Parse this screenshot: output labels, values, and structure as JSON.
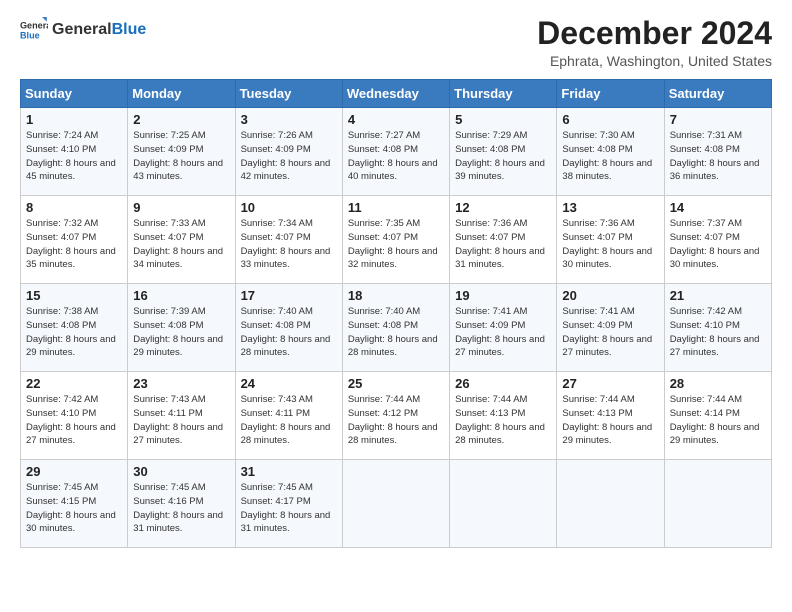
{
  "header": {
    "logo_general": "General",
    "logo_blue": "Blue",
    "title": "December 2024",
    "subtitle": "Ephrata, Washington, United States"
  },
  "weekdays": [
    "Sunday",
    "Monday",
    "Tuesday",
    "Wednesday",
    "Thursday",
    "Friday",
    "Saturday"
  ],
  "weeks": [
    [
      {
        "day": "1",
        "sunrise": "Sunrise: 7:24 AM",
        "sunset": "Sunset: 4:10 PM",
        "daylight": "Daylight: 8 hours and 45 minutes."
      },
      {
        "day": "2",
        "sunrise": "Sunrise: 7:25 AM",
        "sunset": "Sunset: 4:09 PM",
        "daylight": "Daylight: 8 hours and 43 minutes."
      },
      {
        "day": "3",
        "sunrise": "Sunrise: 7:26 AM",
        "sunset": "Sunset: 4:09 PM",
        "daylight": "Daylight: 8 hours and 42 minutes."
      },
      {
        "day": "4",
        "sunrise": "Sunrise: 7:27 AM",
        "sunset": "Sunset: 4:08 PM",
        "daylight": "Daylight: 8 hours and 40 minutes."
      },
      {
        "day": "5",
        "sunrise": "Sunrise: 7:29 AM",
        "sunset": "Sunset: 4:08 PM",
        "daylight": "Daylight: 8 hours and 39 minutes."
      },
      {
        "day": "6",
        "sunrise": "Sunrise: 7:30 AM",
        "sunset": "Sunset: 4:08 PM",
        "daylight": "Daylight: 8 hours and 38 minutes."
      },
      {
        "day": "7",
        "sunrise": "Sunrise: 7:31 AM",
        "sunset": "Sunset: 4:08 PM",
        "daylight": "Daylight: 8 hours and 36 minutes."
      }
    ],
    [
      {
        "day": "8",
        "sunrise": "Sunrise: 7:32 AM",
        "sunset": "Sunset: 4:07 PM",
        "daylight": "Daylight: 8 hours and 35 minutes."
      },
      {
        "day": "9",
        "sunrise": "Sunrise: 7:33 AM",
        "sunset": "Sunset: 4:07 PM",
        "daylight": "Daylight: 8 hours and 34 minutes."
      },
      {
        "day": "10",
        "sunrise": "Sunrise: 7:34 AM",
        "sunset": "Sunset: 4:07 PM",
        "daylight": "Daylight: 8 hours and 33 minutes."
      },
      {
        "day": "11",
        "sunrise": "Sunrise: 7:35 AM",
        "sunset": "Sunset: 4:07 PM",
        "daylight": "Daylight: 8 hours and 32 minutes."
      },
      {
        "day": "12",
        "sunrise": "Sunrise: 7:36 AM",
        "sunset": "Sunset: 4:07 PM",
        "daylight": "Daylight: 8 hours and 31 minutes."
      },
      {
        "day": "13",
        "sunrise": "Sunrise: 7:36 AM",
        "sunset": "Sunset: 4:07 PM",
        "daylight": "Daylight: 8 hours and 30 minutes."
      },
      {
        "day": "14",
        "sunrise": "Sunrise: 7:37 AM",
        "sunset": "Sunset: 4:07 PM",
        "daylight": "Daylight: 8 hours and 30 minutes."
      }
    ],
    [
      {
        "day": "15",
        "sunrise": "Sunrise: 7:38 AM",
        "sunset": "Sunset: 4:08 PM",
        "daylight": "Daylight: 8 hours and 29 minutes."
      },
      {
        "day": "16",
        "sunrise": "Sunrise: 7:39 AM",
        "sunset": "Sunset: 4:08 PM",
        "daylight": "Daylight: 8 hours and 29 minutes."
      },
      {
        "day": "17",
        "sunrise": "Sunrise: 7:40 AM",
        "sunset": "Sunset: 4:08 PM",
        "daylight": "Daylight: 8 hours and 28 minutes."
      },
      {
        "day": "18",
        "sunrise": "Sunrise: 7:40 AM",
        "sunset": "Sunset: 4:08 PM",
        "daylight": "Daylight: 8 hours and 28 minutes."
      },
      {
        "day": "19",
        "sunrise": "Sunrise: 7:41 AM",
        "sunset": "Sunset: 4:09 PM",
        "daylight": "Daylight: 8 hours and 27 minutes."
      },
      {
        "day": "20",
        "sunrise": "Sunrise: 7:41 AM",
        "sunset": "Sunset: 4:09 PM",
        "daylight": "Daylight: 8 hours and 27 minutes."
      },
      {
        "day": "21",
        "sunrise": "Sunrise: 7:42 AM",
        "sunset": "Sunset: 4:10 PM",
        "daylight": "Daylight: 8 hours and 27 minutes."
      }
    ],
    [
      {
        "day": "22",
        "sunrise": "Sunrise: 7:42 AM",
        "sunset": "Sunset: 4:10 PM",
        "daylight": "Daylight: 8 hours and 27 minutes."
      },
      {
        "day": "23",
        "sunrise": "Sunrise: 7:43 AM",
        "sunset": "Sunset: 4:11 PM",
        "daylight": "Daylight: 8 hours and 27 minutes."
      },
      {
        "day": "24",
        "sunrise": "Sunrise: 7:43 AM",
        "sunset": "Sunset: 4:11 PM",
        "daylight": "Daylight: 8 hours and 28 minutes."
      },
      {
        "day": "25",
        "sunrise": "Sunrise: 7:44 AM",
        "sunset": "Sunset: 4:12 PM",
        "daylight": "Daylight: 8 hours and 28 minutes."
      },
      {
        "day": "26",
        "sunrise": "Sunrise: 7:44 AM",
        "sunset": "Sunset: 4:13 PM",
        "daylight": "Daylight: 8 hours and 28 minutes."
      },
      {
        "day": "27",
        "sunrise": "Sunrise: 7:44 AM",
        "sunset": "Sunset: 4:13 PM",
        "daylight": "Daylight: 8 hours and 29 minutes."
      },
      {
        "day": "28",
        "sunrise": "Sunrise: 7:44 AM",
        "sunset": "Sunset: 4:14 PM",
        "daylight": "Daylight: 8 hours and 29 minutes."
      }
    ],
    [
      {
        "day": "29",
        "sunrise": "Sunrise: 7:45 AM",
        "sunset": "Sunset: 4:15 PM",
        "daylight": "Daylight: 8 hours and 30 minutes."
      },
      {
        "day": "30",
        "sunrise": "Sunrise: 7:45 AM",
        "sunset": "Sunset: 4:16 PM",
        "daylight": "Daylight: 8 hours and 31 minutes."
      },
      {
        "day": "31",
        "sunrise": "Sunrise: 7:45 AM",
        "sunset": "Sunset: 4:17 PM",
        "daylight": "Daylight: 8 hours and 31 minutes."
      },
      null,
      null,
      null,
      null
    ]
  ]
}
